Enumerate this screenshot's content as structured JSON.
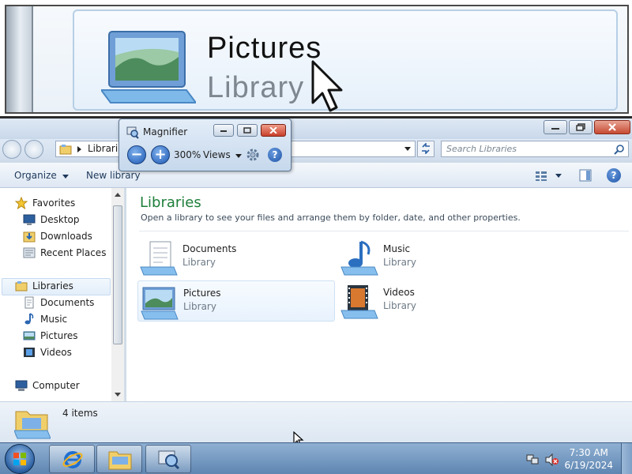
{
  "lens": {
    "title": "Pictures",
    "subtitle": "Library"
  },
  "explorer": {
    "address_crumb": "Librarie",
    "search_placeholder": "Search Libraries",
    "toolbar": {
      "organize": "Organize",
      "new_library": "New library"
    },
    "nav": {
      "favorites": "Favorites",
      "desktop": "Desktop",
      "downloads": "Downloads",
      "recent_places": "Recent Places",
      "libraries": "Libraries",
      "documents": "Documents",
      "music": "Music",
      "pictures": "Pictures",
      "videos": "Videos",
      "computer": "Computer"
    },
    "content": {
      "title": "Libraries",
      "description": "Open a library to see your files and arrange them by folder, date, and other properties."
    },
    "tiles": [
      {
        "name": "Documents",
        "type": "Library"
      },
      {
        "name": "Music",
        "type": "Library"
      },
      {
        "name": "Pictures",
        "type": "Library"
      },
      {
        "name": "Videos",
        "type": "Library"
      }
    ],
    "status": "4 items"
  },
  "magnifier": {
    "title": "Magnifier",
    "zoom": "300%",
    "views_label": "Views"
  },
  "taskbar": {
    "time": "7:30 AM",
    "date": "6/19/2024"
  }
}
